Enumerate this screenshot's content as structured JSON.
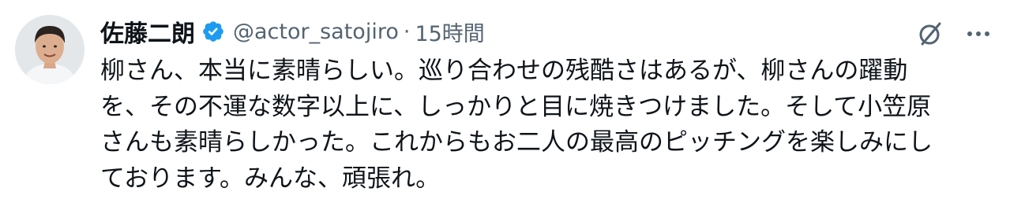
{
  "author": {
    "display_name": "佐藤二朗",
    "handle": "@actor_satojiro",
    "separator": "·",
    "timestamp": "15時間",
    "verified_icon": "verified-badge-icon",
    "avatar_icon": "profile-photo"
  },
  "actions": {
    "grok_icon": "grok-slash-icon",
    "more_icon": "more-dots-icon"
  },
  "tweet": {
    "lines": [
      "柳さん、本当に素晴らしい。巡り合わせの残酷さはあるが、柳さんの躍動",
      "を、その不運な数字以上に、しっかりと目に焼きつけました。そして小笠原",
      "さんも素晴らしかった。これからもお二人の最高のピッチングを楽しみにし",
      "ております。みんな、頑張れ。"
    ]
  },
  "colors": {
    "text_primary": "#0f1419",
    "text_secondary": "#536471",
    "verified_blue": "#1d9bf0"
  }
}
